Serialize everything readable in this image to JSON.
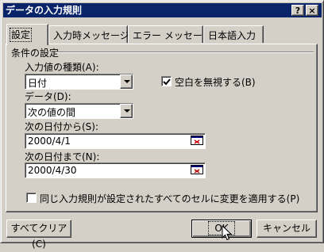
{
  "window": {
    "title": "データの入力規則",
    "help_glyph": "?",
    "close_glyph": "×"
  },
  "tabs": [
    {
      "label": "設定",
      "active": true
    },
    {
      "label": "入力時メッセージ",
      "active": false
    },
    {
      "label": "エラー メッセージ",
      "active": false
    },
    {
      "label": "日本語入力",
      "active": false
    }
  ],
  "conditions": {
    "group_label": "条件の設定",
    "allow_label": "入力値の種類(A):",
    "allow_value": "日付",
    "ignore_blank_label": "空白を無視する(B)",
    "ignore_blank_checked": true,
    "data_label": "データ(D):",
    "data_value": "次の値の間",
    "start_label": "次の日付から(S):",
    "start_value": "2000/4/1",
    "end_label": "次の日付まで(N):",
    "end_value": "2000/4/30"
  },
  "apply_all": {
    "label": "同じ入力規則が設定されたすべてのセルに変更を適用する(P)",
    "checked": false
  },
  "buttons": {
    "clear_all": "すべてクリア(C)",
    "ok": "OK",
    "cancel": "キャンセル"
  },
  "icons": [
    "help-icon",
    "close-icon",
    "dropdown-arrow-icon",
    "range-reference-icon",
    "checkmark-icon",
    "mouse-cursor-icon"
  ]
}
